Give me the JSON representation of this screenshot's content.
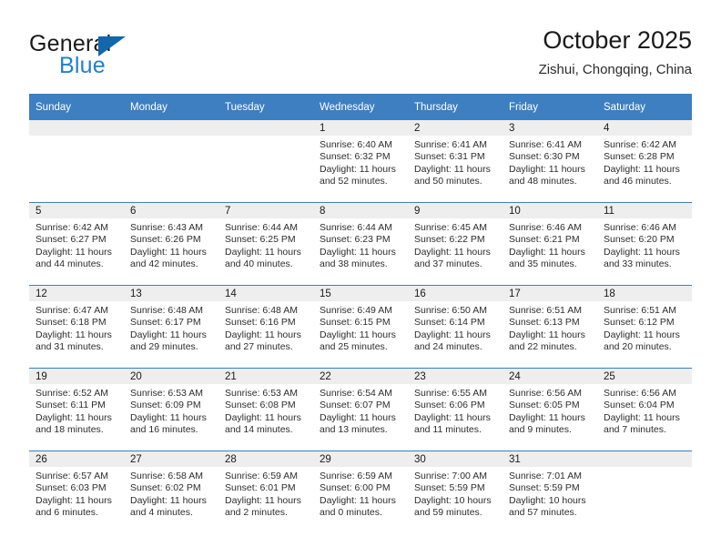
{
  "brand": {
    "word_one": "General",
    "word_two": "Blue",
    "accent_color": "#1f7fd4",
    "triangle_color": "#1267ad",
    "triangle_icon": "triangle-icon"
  },
  "header": {
    "title": "October 2025",
    "subtitle": "Zishui, Chongqing, China"
  },
  "calendar": {
    "header_bg": "#3d7fc1",
    "daynum_bg": "#eeeeee",
    "weekday_headers": [
      "Sunday",
      "Monday",
      "Tuesday",
      "Wednesday",
      "Thursday",
      "Friday",
      "Saturday"
    ],
    "weeks": [
      [
        {
          "day": "",
          "sunrise": "",
          "sunset": "",
          "daylight_line1": "",
          "daylight_line2": "",
          "empty": true
        },
        {
          "day": "",
          "sunrise": "",
          "sunset": "",
          "daylight_line1": "",
          "daylight_line2": "",
          "empty": true
        },
        {
          "day": "",
          "sunrise": "",
          "sunset": "",
          "daylight_line1": "",
          "daylight_line2": "",
          "empty": true
        },
        {
          "day": "1",
          "sunrise": "Sunrise: 6:40 AM",
          "sunset": "Sunset: 6:32 PM",
          "daylight_line1": "Daylight: 11 hours",
          "daylight_line2": "and 52 minutes."
        },
        {
          "day": "2",
          "sunrise": "Sunrise: 6:41 AM",
          "sunset": "Sunset: 6:31 PM",
          "daylight_line1": "Daylight: 11 hours",
          "daylight_line2": "and 50 minutes."
        },
        {
          "day": "3",
          "sunrise": "Sunrise: 6:41 AM",
          "sunset": "Sunset: 6:30 PM",
          "daylight_line1": "Daylight: 11 hours",
          "daylight_line2": "and 48 minutes."
        },
        {
          "day": "4",
          "sunrise": "Sunrise: 6:42 AM",
          "sunset": "Sunset: 6:28 PM",
          "daylight_line1": "Daylight: 11 hours",
          "daylight_line2": "and 46 minutes."
        }
      ],
      [
        {
          "day": "5",
          "sunrise": "Sunrise: 6:42 AM",
          "sunset": "Sunset: 6:27 PM",
          "daylight_line1": "Daylight: 11 hours",
          "daylight_line2": "and 44 minutes."
        },
        {
          "day": "6",
          "sunrise": "Sunrise: 6:43 AM",
          "sunset": "Sunset: 6:26 PM",
          "daylight_line1": "Daylight: 11 hours",
          "daylight_line2": "and 42 minutes."
        },
        {
          "day": "7",
          "sunrise": "Sunrise: 6:44 AM",
          "sunset": "Sunset: 6:25 PM",
          "daylight_line1": "Daylight: 11 hours",
          "daylight_line2": "and 40 minutes."
        },
        {
          "day": "8",
          "sunrise": "Sunrise: 6:44 AM",
          "sunset": "Sunset: 6:23 PM",
          "daylight_line1": "Daylight: 11 hours",
          "daylight_line2": "and 38 minutes."
        },
        {
          "day": "9",
          "sunrise": "Sunrise: 6:45 AM",
          "sunset": "Sunset: 6:22 PM",
          "daylight_line1": "Daylight: 11 hours",
          "daylight_line2": "and 37 minutes."
        },
        {
          "day": "10",
          "sunrise": "Sunrise: 6:46 AM",
          "sunset": "Sunset: 6:21 PM",
          "daylight_line1": "Daylight: 11 hours",
          "daylight_line2": "and 35 minutes."
        },
        {
          "day": "11",
          "sunrise": "Sunrise: 6:46 AM",
          "sunset": "Sunset: 6:20 PM",
          "daylight_line1": "Daylight: 11 hours",
          "daylight_line2": "and 33 minutes."
        }
      ],
      [
        {
          "day": "12",
          "sunrise": "Sunrise: 6:47 AM",
          "sunset": "Sunset: 6:18 PM",
          "daylight_line1": "Daylight: 11 hours",
          "daylight_line2": "and 31 minutes."
        },
        {
          "day": "13",
          "sunrise": "Sunrise: 6:48 AM",
          "sunset": "Sunset: 6:17 PM",
          "daylight_line1": "Daylight: 11 hours",
          "daylight_line2": "and 29 minutes."
        },
        {
          "day": "14",
          "sunrise": "Sunrise: 6:48 AM",
          "sunset": "Sunset: 6:16 PM",
          "daylight_line1": "Daylight: 11 hours",
          "daylight_line2": "and 27 minutes."
        },
        {
          "day": "15",
          "sunrise": "Sunrise: 6:49 AM",
          "sunset": "Sunset: 6:15 PM",
          "daylight_line1": "Daylight: 11 hours",
          "daylight_line2": "and 25 minutes."
        },
        {
          "day": "16",
          "sunrise": "Sunrise: 6:50 AM",
          "sunset": "Sunset: 6:14 PM",
          "daylight_line1": "Daylight: 11 hours",
          "daylight_line2": "and 24 minutes."
        },
        {
          "day": "17",
          "sunrise": "Sunrise: 6:51 AM",
          "sunset": "Sunset: 6:13 PM",
          "daylight_line1": "Daylight: 11 hours",
          "daylight_line2": "and 22 minutes."
        },
        {
          "day": "18",
          "sunrise": "Sunrise: 6:51 AM",
          "sunset": "Sunset: 6:12 PM",
          "daylight_line1": "Daylight: 11 hours",
          "daylight_line2": "and 20 minutes."
        }
      ],
      [
        {
          "day": "19",
          "sunrise": "Sunrise: 6:52 AM",
          "sunset": "Sunset: 6:11 PM",
          "daylight_line1": "Daylight: 11 hours",
          "daylight_line2": "and 18 minutes."
        },
        {
          "day": "20",
          "sunrise": "Sunrise: 6:53 AM",
          "sunset": "Sunset: 6:09 PM",
          "daylight_line1": "Daylight: 11 hours",
          "daylight_line2": "and 16 minutes."
        },
        {
          "day": "21",
          "sunrise": "Sunrise: 6:53 AM",
          "sunset": "Sunset: 6:08 PM",
          "daylight_line1": "Daylight: 11 hours",
          "daylight_line2": "and 14 minutes."
        },
        {
          "day": "22",
          "sunrise": "Sunrise: 6:54 AM",
          "sunset": "Sunset: 6:07 PM",
          "daylight_line1": "Daylight: 11 hours",
          "daylight_line2": "and 13 minutes."
        },
        {
          "day": "23",
          "sunrise": "Sunrise: 6:55 AM",
          "sunset": "Sunset: 6:06 PM",
          "daylight_line1": "Daylight: 11 hours",
          "daylight_line2": "and 11 minutes."
        },
        {
          "day": "24",
          "sunrise": "Sunrise: 6:56 AM",
          "sunset": "Sunset: 6:05 PM",
          "daylight_line1": "Daylight: 11 hours",
          "daylight_line2": "and 9 minutes."
        },
        {
          "day": "25",
          "sunrise": "Sunrise: 6:56 AM",
          "sunset": "Sunset: 6:04 PM",
          "daylight_line1": "Daylight: 11 hours",
          "daylight_line2": "and 7 minutes."
        }
      ],
      [
        {
          "day": "26",
          "sunrise": "Sunrise: 6:57 AM",
          "sunset": "Sunset: 6:03 PM",
          "daylight_line1": "Daylight: 11 hours",
          "daylight_line2": "and 6 minutes."
        },
        {
          "day": "27",
          "sunrise": "Sunrise: 6:58 AM",
          "sunset": "Sunset: 6:02 PM",
          "daylight_line1": "Daylight: 11 hours",
          "daylight_line2": "and 4 minutes."
        },
        {
          "day": "28",
          "sunrise": "Sunrise: 6:59 AM",
          "sunset": "Sunset: 6:01 PM",
          "daylight_line1": "Daylight: 11 hours",
          "daylight_line2": "and 2 minutes."
        },
        {
          "day": "29",
          "sunrise": "Sunrise: 6:59 AM",
          "sunset": "Sunset: 6:00 PM",
          "daylight_line1": "Daylight: 11 hours",
          "daylight_line2": "and 0 minutes."
        },
        {
          "day": "30",
          "sunrise": "Sunrise: 7:00 AM",
          "sunset": "Sunset: 5:59 PM",
          "daylight_line1": "Daylight: 10 hours",
          "daylight_line2": "and 59 minutes."
        },
        {
          "day": "31",
          "sunrise": "Sunrise: 7:01 AM",
          "sunset": "Sunset: 5:59 PM",
          "daylight_line1": "Daylight: 10 hours",
          "daylight_line2": "and 57 minutes."
        },
        {
          "day": "",
          "sunrise": "",
          "sunset": "",
          "daylight_line1": "",
          "daylight_line2": "",
          "empty": true
        }
      ]
    ]
  }
}
